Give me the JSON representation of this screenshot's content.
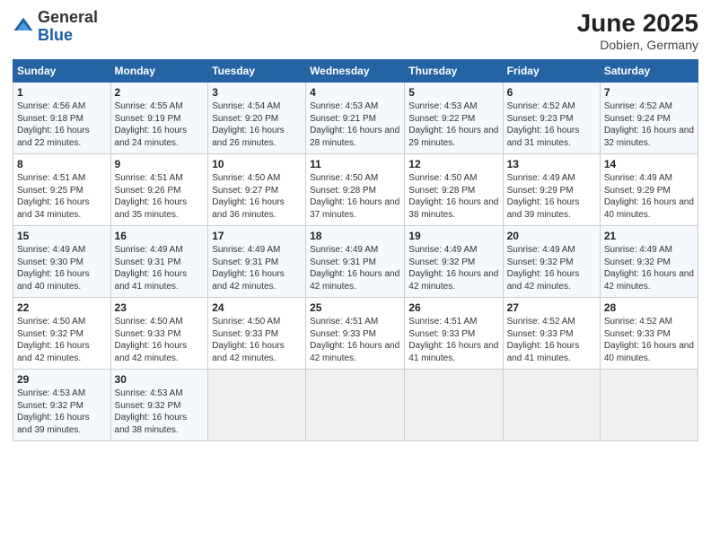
{
  "header": {
    "logo_general": "General",
    "logo_blue": "Blue",
    "month_year": "June 2025",
    "location": "Dobien, Germany"
  },
  "days_of_week": [
    "Sunday",
    "Monday",
    "Tuesday",
    "Wednesday",
    "Thursday",
    "Friday",
    "Saturday"
  ],
  "weeks": [
    [
      {
        "day": 1,
        "sunrise": "4:56 AM",
        "sunset": "9:18 PM",
        "daylight": "16 hours and 22 minutes."
      },
      {
        "day": 2,
        "sunrise": "4:55 AM",
        "sunset": "9:19 PM",
        "daylight": "16 hours and 24 minutes."
      },
      {
        "day": 3,
        "sunrise": "4:54 AM",
        "sunset": "9:20 PM",
        "daylight": "16 hours and 26 minutes."
      },
      {
        "day": 4,
        "sunrise": "4:53 AM",
        "sunset": "9:21 PM",
        "daylight": "16 hours and 28 minutes."
      },
      {
        "day": 5,
        "sunrise": "4:53 AM",
        "sunset": "9:22 PM",
        "daylight": "16 hours and 29 minutes."
      },
      {
        "day": 6,
        "sunrise": "4:52 AM",
        "sunset": "9:23 PM",
        "daylight": "16 hours and 31 minutes."
      },
      {
        "day": 7,
        "sunrise": "4:52 AM",
        "sunset": "9:24 PM",
        "daylight": "16 hours and 32 minutes."
      }
    ],
    [
      {
        "day": 8,
        "sunrise": "4:51 AM",
        "sunset": "9:25 PM",
        "daylight": "16 hours and 34 minutes."
      },
      {
        "day": 9,
        "sunrise": "4:51 AM",
        "sunset": "9:26 PM",
        "daylight": "16 hours and 35 minutes."
      },
      {
        "day": 10,
        "sunrise": "4:50 AM",
        "sunset": "9:27 PM",
        "daylight": "16 hours and 36 minutes."
      },
      {
        "day": 11,
        "sunrise": "4:50 AM",
        "sunset": "9:28 PM",
        "daylight": "16 hours and 37 minutes."
      },
      {
        "day": 12,
        "sunrise": "4:50 AM",
        "sunset": "9:28 PM",
        "daylight": "16 hours and 38 minutes."
      },
      {
        "day": 13,
        "sunrise": "4:49 AM",
        "sunset": "9:29 PM",
        "daylight": "16 hours and 39 minutes."
      },
      {
        "day": 14,
        "sunrise": "4:49 AM",
        "sunset": "9:29 PM",
        "daylight": "16 hours and 40 minutes."
      }
    ],
    [
      {
        "day": 15,
        "sunrise": "4:49 AM",
        "sunset": "9:30 PM",
        "daylight": "16 hours and 40 minutes."
      },
      {
        "day": 16,
        "sunrise": "4:49 AM",
        "sunset": "9:31 PM",
        "daylight": "16 hours and 41 minutes."
      },
      {
        "day": 17,
        "sunrise": "4:49 AM",
        "sunset": "9:31 PM",
        "daylight": "16 hours and 42 minutes."
      },
      {
        "day": 18,
        "sunrise": "4:49 AM",
        "sunset": "9:31 PM",
        "daylight": "16 hours and 42 minutes."
      },
      {
        "day": 19,
        "sunrise": "4:49 AM",
        "sunset": "9:32 PM",
        "daylight": "16 hours and 42 minutes."
      },
      {
        "day": 20,
        "sunrise": "4:49 AM",
        "sunset": "9:32 PM",
        "daylight": "16 hours and 42 minutes."
      },
      {
        "day": 21,
        "sunrise": "4:49 AM",
        "sunset": "9:32 PM",
        "daylight": "16 hours and 42 minutes."
      }
    ],
    [
      {
        "day": 22,
        "sunrise": "4:50 AM",
        "sunset": "9:32 PM",
        "daylight": "16 hours and 42 minutes."
      },
      {
        "day": 23,
        "sunrise": "4:50 AM",
        "sunset": "9:33 PM",
        "daylight": "16 hours and 42 minutes."
      },
      {
        "day": 24,
        "sunrise": "4:50 AM",
        "sunset": "9:33 PM",
        "daylight": "16 hours and 42 minutes."
      },
      {
        "day": 25,
        "sunrise": "4:51 AM",
        "sunset": "9:33 PM",
        "daylight": "16 hours and 42 minutes."
      },
      {
        "day": 26,
        "sunrise": "4:51 AM",
        "sunset": "9:33 PM",
        "daylight": "16 hours and 41 minutes."
      },
      {
        "day": 27,
        "sunrise": "4:52 AM",
        "sunset": "9:33 PM",
        "daylight": "16 hours and 41 minutes."
      },
      {
        "day": 28,
        "sunrise": "4:52 AM",
        "sunset": "9:33 PM",
        "daylight": "16 hours and 40 minutes."
      }
    ],
    [
      {
        "day": 29,
        "sunrise": "4:53 AM",
        "sunset": "9:32 PM",
        "daylight": "16 hours and 39 minutes."
      },
      {
        "day": 30,
        "sunrise": "4:53 AM",
        "sunset": "9:32 PM",
        "daylight": "16 hours and 38 minutes."
      },
      null,
      null,
      null,
      null,
      null
    ]
  ]
}
